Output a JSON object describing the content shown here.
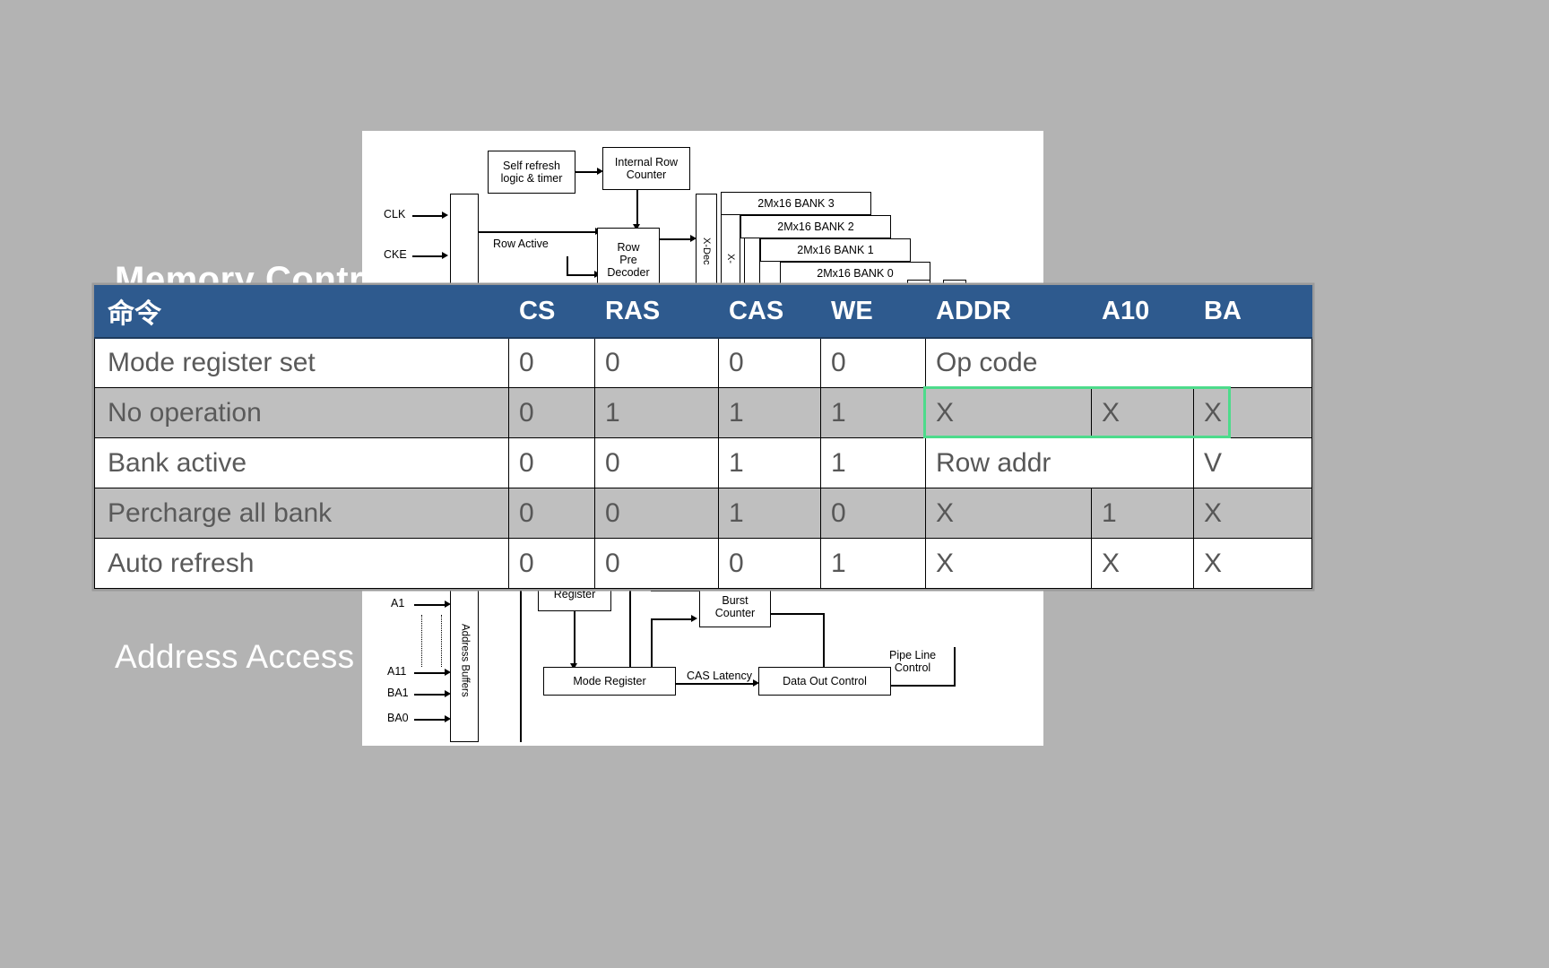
{
  "slide": {
    "title": "Memory Control",
    "subtitle": "Address Access",
    "background_color": "#b3b3b3",
    "header_color": "#2e5a8e",
    "shade_row_color": "#bfbfbf",
    "selection_color": "#4ddb8b"
  },
  "table": {
    "name": "sdram-command-truth-table",
    "columns": [
      {
        "key": "command",
        "label": "命令"
      },
      {
        "key": "cs",
        "label": "CS"
      },
      {
        "key": "ras",
        "label": "RAS"
      },
      {
        "key": "cas",
        "label": "CAS"
      },
      {
        "key": "we",
        "label": "WE"
      },
      {
        "key": "addr",
        "label": "ADDR"
      },
      {
        "key": "a10",
        "label": "A10"
      },
      {
        "key": "ba",
        "label": "BA"
      }
    ],
    "rows": [
      {
        "command": "Mode register set",
        "cs": "0",
        "ras": "0",
        "cas": "0",
        "we": "0",
        "we_small": true,
        "addr": "Op code",
        "addr_span": 3,
        "a10": "",
        "ba": "",
        "shaded": false
      },
      {
        "command": "No operation",
        "cs": "0",
        "ras": "1",
        "cas": "1",
        "we": "1",
        "we_small": false,
        "addr": "X",
        "addr_span": 1,
        "a10": "X",
        "ba": "X",
        "shaded": true,
        "selected": true
      },
      {
        "command": "Bank active",
        "cs": "0",
        "ras": "0",
        "cas": "1",
        "we": "1",
        "we_small": true,
        "addr": "Row addr",
        "addr_span": 2,
        "a10": "",
        "ba": "V",
        "shaded": false
      },
      {
        "command": "Percharge all bank",
        "cs": "0",
        "ras": "0",
        "cas": "1",
        "we": "0",
        "we_small": true,
        "addr": "X",
        "addr_span": 1,
        "a10": "1",
        "ba": "X",
        "shaded": true
      },
      {
        "command": "Auto refresh",
        "cs": "0",
        "ras": "0",
        "cas": "0",
        "we": "1",
        "we_small": true,
        "addr": "X",
        "addr_span": 1,
        "a10": "X",
        "ba": "X",
        "shaded": false
      }
    ]
  },
  "diagram": {
    "name": "sdram-block-diagram",
    "boxes": [
      {
        "id": "self-refresh",
        "text": "Self refresh\nlogic & timer"
      },
      {
        "id": "internal-row-counter",
        "text": "Internal Row\nCounter"
      },
      {
        "id": "row-pre-decoder",
        "text": "Row\nPre\nDecoder"
      },
      {
        "id": "bank3",
        "text": "2Mx16 BANK 3"
      },
      {
        "id": "bank2",
        "text": "2Mx16 BANK 2"
      },
      {
        "id": "bank1",
        "text": "2Mx16 BANK 1"
      },
      {
        "id": "bank0",
        "text": "2Mx16 BANK 0"
      },
      {
        "id": "register",
        "text": "Register"
      },
      {
        "id": "burst-counter",
        "text": "Burst\nCounter"
      },
      {
        "id": "mode-register",
        "text": "Mode Register"
      },
      {
        "id": "data-out-control",
        "text": "Data Out Control"
      },
      {
        "id": "address-buffers",
        "text": "Address Buffers"
      },
      {
        "id": "x-decoder",
        "text": "X-Decoder"
      }
    ],
    "labels": [
      {
        "id": "clk",
        "text": "CLK"
      },
      {
        "id": "cke",
        "text": "CKE"
      },
      {
        "id": "row-active",
        "text": "Row Active"
      },
      {
        "id": "a1",
        "text": "A1"
      },
      {
        "id": "a11",
        "text": "A11"
      },
      {
        "id": "ba1",
        "text": "BA1"
      },
      {
        "id": "ba0",
        "text": "BA0"
      },
      {
        "id": "cas-latency",
        "text": "CAS Latency"
      },
      {
        "id": "pipeline-control",
        "text": "Pipe Line\nControl"
      },
      {
        "id": "dots",
        "text": "......."
      }
    ]
  }
}
